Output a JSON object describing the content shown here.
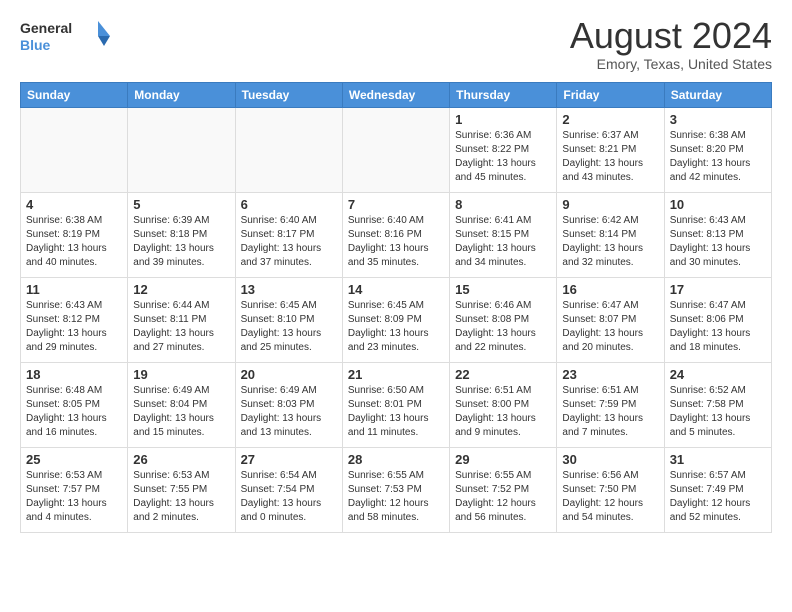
{
  "header": {
    "logo_line1": "General",
    "logo_line2": "Blue",
    "month": "August 2024",
    "location": "Emory, Texas, United States"
  },
  "weekdays": [
    "Sunday",
    "Monday",
    "Tuesday",
    "Wednesday",
    "Thursday",
    "Friday",
    "Saturday"
  ],
  "weeks": [
    [
      {
        "day": "",
        "content": ""
      },
      {
        "day": "",
        "content": ""
      },
      {
        "day": "",
        "content": ""
      },
      {
        "day": "",
        "content": ""
      },
      {
        "day": "1",
        "content": "Sunrise: 6:36 AM\nSunset: 8:22 PM\nDaylight: 13 hours\nand 45 minutes."
      },
      {
        "day": "2",
        "content": "Sunrise: 6:37 AM\nSunset: 8:21 PM\nDaylight: 13 hours\nand 43 minutes."
      },
      {
        "day": "3",
        "content": "Sunrise: 6:38 AM\nSunset: 8:20 PM\nDaylight: 13 hours\nand 42 minutes."
      }
    ],
    [
      {
        "day": "4",
        "content": "Sunrise: 6:38 AM\nSunset: 8:19 PM\nDaylight: 13 hours\nand 40 minutes."
      },
      {
        "day": "5",
        "content": "Sunrise: 6:39 AM\nSunset: 8:18 PM\nDaylight: 13 hours\nand 39 minutes."
      },
      {
        "day": "6",
        "content": "Sunrise: 6:40 AM\nSunset: 8:17 PM\nDaylight: 13 hours\nand 37 minutes."
      },
      {
        "day": "7",
        "content": "Sunrise: 6:40 AM\nSunset: 8:16 PM\nDaylight: 13 hours\nand 35 minutes."
      },
      {
        "day": "8",
        "content": "Sunrise: 6:41 AM\nSunset: 8:15 PM\nDaylight: 13 hours\nand 34 minutes."
      },
      {
        "day": "9",
        "content": "Sunrise: 6:42 AM\nSunset: 8:14 PM\nDaylight: 13 hours\nand 32 minutes."
      },
      {
        "day": "10",
        "content": "Sunrise: 6:43 AM\nSunset: 8:13 PM\nDaylight: 13 hours\nand 30 minutes."
      }
    ],
    [
      {
        "day": "11",
        "content": "Sunrise: 6:43 AM\nSunset: 8:12 PM\nDaylight: 13 hours\nand 29 minutes."
      },
      {
        "day": "12",
        "content": "Sunrise: 6:44 AM\nSunset: 8:11 PM\nDaylight: 13 hours\nand 27 minutes."
      },
      {
        "day": "13",
        "content": "Sunrise: 6:45 AM\nSunset: 8:10 PM\nDaylight: 13 hours\nand 25 minutes."
      },
      {
        "day": "14",
        "content": "Sunrise: 6:45 AM\nSunset: 8:09 PM\nDaylight: 13 hours\nand 23 minutes."
      },
      {
        "day": "15",
        "content": "Sunrise: 6:46 AM\nSunset: 8:08 PM\nDaylight: 13 hours\nand 22 minutes."
      },
      {
        "day": "16",
        "content": "Sunrise: 6:47 AM\nSunset: 8:07 PM\nDaylight: 13 hours\nand 20 minutes."
      },
      {
        "day": "17",
        "content": "Sunrise: 6:47 AM\nSunset: 8:06 PM\nDaylight: 13 hours\nand 18 minutes."
      }
    ],
    [
      {
        "day": "18",
        "content": "Sunrise: 6:48 AM\nSunset: 8:05 PM\nDaylight: 13 hours\nand 16 minutes."
      },
      {
        "day": "19",
        "content": "Sunrise: 6:49 AM\nSunset: 8:04 PM\nDaylight: 13 hours\nand 15 minutes."
      },
      {
        "day": "20",
        "content": "Sunrise: 6:49 AM\nSunset: 8:03 PM\nDaylight: 13 hours\nand 13 minutes."
      },
      {
        "day": "21",
        "content": "Sunrise: 6:50 AM\nSunset: 8:01 PM\nDaylight: 13 hours\nand 11 minutes."
      },
      {
        "day": "22",
        "content": "Sunrise: 6:51 AM\nSunset: 8:00 PM\nDaylight: 13 hours\nand 9 minutes."
      },
      {
        "day": "23",
        "content": "Sunrise: 6:51 AM\nSunset: 7:59 PM\nDaylight: 13 hours\nand 7 minutes."
      },
      {
        "day": "24",
        "content": "Sunrise: 6:52 AM\nSunset: 7:58 PM\nDaylight: 13 hours\nand 5 minutes."
      }
    ],
    [
      {
        "day": "25",
        "content": "Sunrise: 6:53 AM\nSunset: 7:57 PM\nDaylight: 13 hours\nand 4 minutes."
      },
      {
        "day": "26",
        "content": "Sunrise: 6:53 AM\nSunset: 7:55 PM\nDaylight: 13 hours\nand 2 minutes."
      },
      {
        "day": "27",
        "content": "Sunrise: 6:54 AM\nSunset: 7:54 PM\nDaylight: 13 hours\nand 0 minutes."
      },
      {
        "day": "28",
        "content": "Sunrise: 6:55 AM\nSunset: 7:53 PM\nDaylight: 12 hours\nand 58 minutes."
      },
      {
        "day": "29",
        "content": "Sunrise: 6:55 AM\nSunset: 7:52 PM\nDaylight: 12 hours\nand 56 minutes."
      },
      {
        "day": "30",
        "content": "Sunrise: 6:56 AM\nSunset: 7:50 PM\nDaylight: 12 hours\nand 54 minutes."
      },
      {
        "day": "31",
        "content": "Sunrise: 6:57 AM\nSunset: 7:49 PM\nDaylight: 12 hours\nand 52 minutes."
      }
    ]
  ]
}
